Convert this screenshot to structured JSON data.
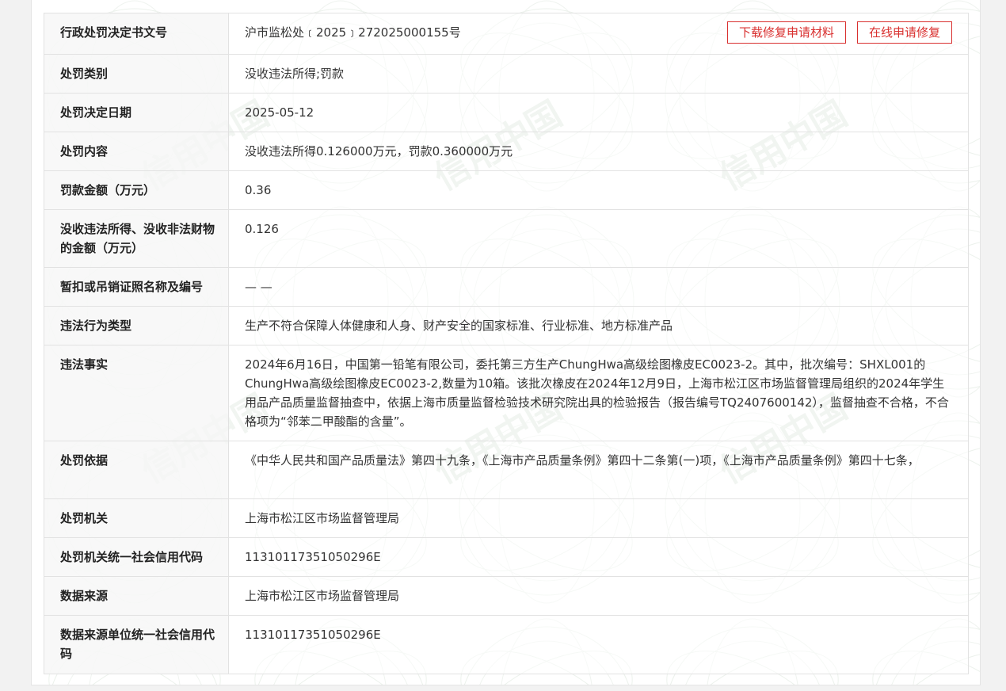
{
  "actions": {
    "download_label": "下载修复申请材料",
    "online_label": "在线申请修复"
  },
  "rows": [
    {
      "label": "行政处罚决定书文号",
      "value": "沪市监松处﹝2025﹞272025000155号"
    },
    {
      "label": "处罚类别",
      "value": "没收违法所得;罚款"
    },
    {
      "label": "处罚决定日期",
      "value": "2025-05-12"
    },
    {
      "label": "处罚内容",
      "value": "没收违法所得0.126000万元，罚款0.360000万元"
    },
    {
      "label": "罚款金额（万元）",
      "value": "0.36"
    },
    {
      "label": "没收违法所得、没收非法财物的金额（万元）",
      "value": "0.126"
    },
    {
      "label": "暂扣或吊销证照名称及编号",
      "value": "— —"
    },
    {
      "label": "违法行为类型",
      "value": "生产不符合保障人体健康和人身、财产安全的国家标准、行业标准、地方标准产品"
    },
    {
      "label": "违法事实",
      "value": "2024年6月16日，中国第一铅笔有限公司，委托第三方生产ChungHwa高级绘图橡皮EC0023-2。其中，批次编号：SHXL001的ChungHwa高级绘图橡皮EC0023-2,数量为10箱。该批次橡皮在2024年12月9日，上海市松江区市场监督管理局组织的2024年学生用品产品质量监督抽查中，依据上海市质量监督检验技术研究院出具的检验报告（报告编号TQ2407600142），监督抽查不合格，不合格项为“邻苯二甲酸酯的含量”。"
    },
    {
      "label": "处罚依据",
      "value": "《中华人民共和国产品质量法》第四十九条，《上海市产品质量条例》第四十二条第(一)项，《上海市产品质量条例》第四十七条，"
    },
    {
      "label": "处罚机关",
      "value": "上海市松江区市场监督管理局"
    },
    {
      "label": "处罚机关统一社会信用代码",
      "value": "11310117351050296E"
    },
    {
      "label": "数据来源",
      "value": "上海市松江区市场监督管理局"
    },
    {
      "label": "数据来源单位统一社会信用代码",
      "value": "11310117351050296E"
    }
  ],
  "watermark": {
    "text": "信用中国",
    "color": "#dfe6df"
  },
  "colors": {
    "accent": "#d9302f",
    "label_bg": "#f7f7f7",
    "border": "#e2e2e2"
  }
}
